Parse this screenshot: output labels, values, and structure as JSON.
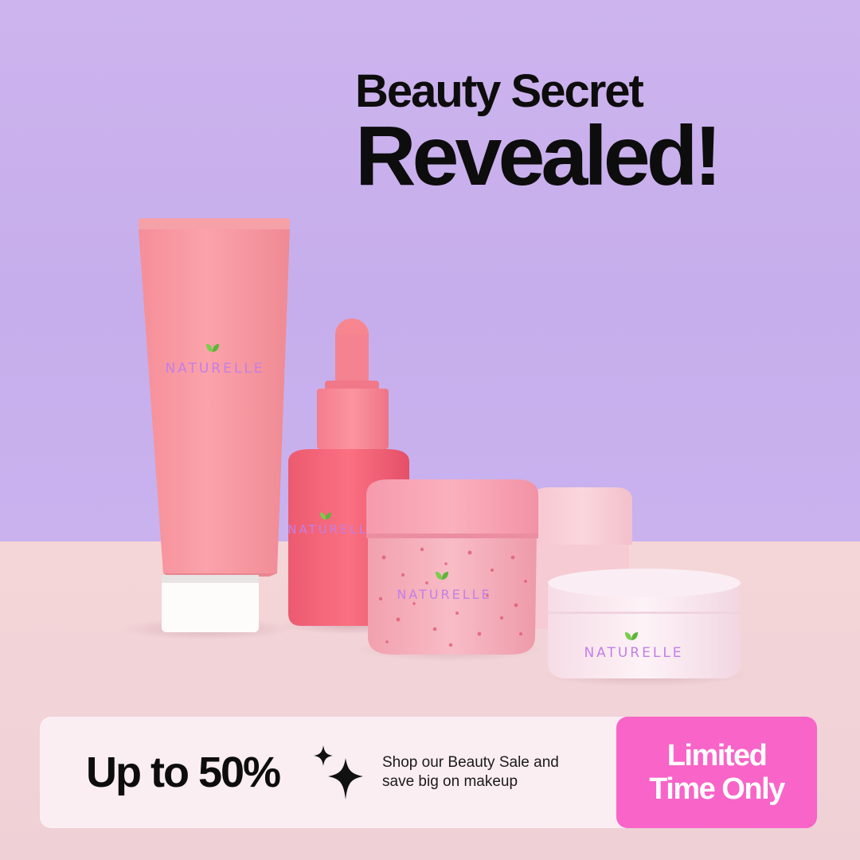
{
  "headline": {
    "line1": "Beauty Secret",
    "line2": "Revealed!"
  },
  "products": {
    "brand": "NATURELLE",
    "items": [
      "cream-tube",
      "serum-dropper-bottle",
      "scrub-jar",
      "lidded-jar-back",
      "cream-jar-white"
    ]
  },
  "promo": {
    "discount": "Up to 50%",
    "desc_line1": "Shop our Beauty Sale and",
    "desc_line2": "save big on makeup",
    "badge_line1": "Limited",
    "badge_line2": "Time Only"
  },
  "colors": {
    "wall": "#cdb4ee",
    "table": "#f4d6d8",
    "brand_text": "#c27fe6",
    "leaf": "#6cc24a",
    "badge": "#f864c8",
    "promo_bar": "#fbeef3"
  },
  "icons": [
    "leaf-icon",
    "sparkle-icon"
  ]
}
